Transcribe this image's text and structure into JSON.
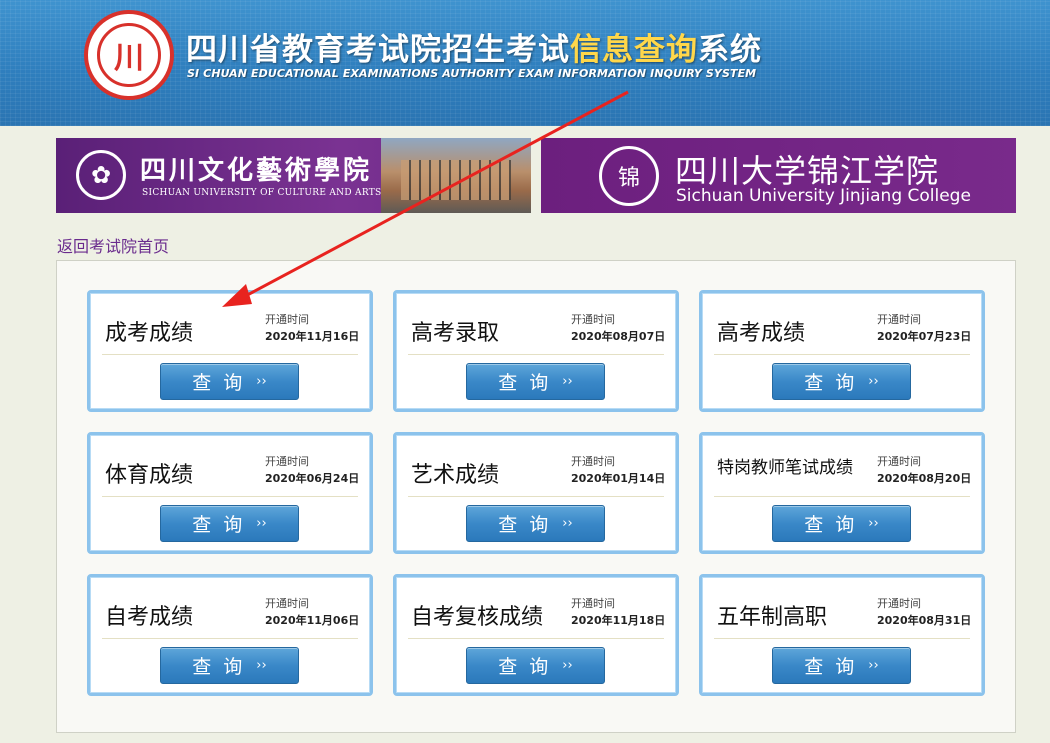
{
  "header": {
    "title_main": "四川省教育考试院招生考试",
    "title_accent": "信息查询",
    "title_tail": "系统",
    "subtitle": "SI CHUAN EDUCATIONAL EXAMINATIONS AUTHORITY EXAM INFORMATION INQUIRY SYSTEM",
    "seal_text": "川"
  },
  "banners": {
    "left": {
      "title": "四川文化藝術學院",
      "subtitle": "SICHUAN UNIVERSITY OF CULTURE AND ARTS"
    },
    "right": {
      "title": "四川大学锦江学院",
      "subtitle": "Sichuan University Jinjiang College",
      "logo_text": "锦"
    }
  },
  "back_link": "返回考试院首页",
  "open_label": "开通时间",
  "button_label": "查询",
  "button_arrow": "››",
  "cards": [
    {
      "title": "成考成绩",
      "date": "2020年11月16日"
    },
    {
      "title": "高考录取",
      "date": "2020年08月07日"
    },
    {
      "title": "高考成绩",
      "date": "2020年07月23日"
    },
    {
      "title": "体育成绩",
      "date": "2020年06月24日"
    },
    {
      "title": "艺术成绩",
      "date": "2020年01月14日"
    },
    {
      "title": "特岗教师笔试成绩",
      "date": "2020年08月20日"
    },
    {
      "title": "自考成绩",
      "date": "2020年11月06日"
    },
    {
      "title": "自考复核成绩",
      "date": "2020年11月18日"
    },
    {
      "title": "五年制高职",
      "date": "2020年08月31日"
    }
  ],
  "colors": {
    "header_blue": "#2f7fbe",
    "accent_yellow": "#ffd74a",
    "seal_red": "#d8312b",
    "banner_purple": "#6c1f7e",
    "button_blue": "#3a88c8",
    "card_border": "#8cc3ec",
    "annotation_red": "#e8231f"
  }
}
